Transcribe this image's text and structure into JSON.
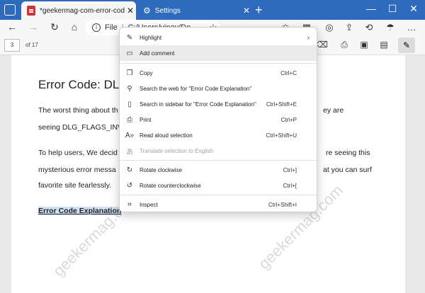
{
  "browser": {
    "tabs": [
      {
        "title": "*geekermag-com-error-code-dlg"
      },
      {
        "title": "Settings"
      }
    ],
    "new_tab": "+",
    "window_controls": [
      "—",
      "☐",
      "✕"
    ],
    "address": {
      "prefix": "File",
      "url": "C:/Users/vinay/De"
    }
  },
  "pdf_toolbar": {
    "page_value": "3",
    "page_total": "of 17"
  },
  "document": {
    "heading": "Error Code: DLG",
    "p1_line1_left": "The worst thing about th",
    "p1_line1_right": "ey are",
    "p1_line2": "seeing DLG_FLAGS_INVA",
    "p2_line1_left": "To help users, We decid",
    "p2_line1_right": "re seeing this",
    "p2_line2_left": "mysterious error messa",
    "p2_line2_right": "at you can surf",
    "p2_line3": "favorite site fearlessly.",
    "bold_heading": "Error Code Explanation"
  },
  "watermark": "geekermag.com",
  "context_menu": {
    "items": [
      {
        "label": "Highlight",
        "shortcut": "",
        "icon": "highlighter-icon",
        "has_submenu": true
      },
      {
        "label": "Add comment",
        "shortcut": "",
        "icon": "comment-icon"
      },
      {
        "label": "Copy",
        "shortcut": "Ctrl+C",
        "icon": "copy-icon"
      },
      {
        "label": "Search the web for \"Error Code Explanation\"",
        "shortcut": "",
        "icon": "search-icon"
      },
      {
        "label": "Search in sidebar for \"Error Code Explanation\"",
        "shortcut": "Ctrl+Shift+E",
        "icon": "sidebar-icon"
      },
      {
        "label": "Print",
        "shortcut": "Ctrl+P",
        "icon": "printer-icon"
      },
      {
        "label": "Read aloud selection",
        "shortcut": "Ctrl+Shift+U",
        "icon": "read-aloud-icon"
      },
      {
        "label": "Translate selection to English",
        "shortcut": "",
        "icon": "translate-icon"
      },
      {
        "label": "Rotate clockwise",
        "shortcut": "Ctrl+]",
        "icon": "rotate-cw-icon"
      },
      {
        "label": "Rotate counterclockwise",
        "shortcut": "Ctrl+[",
        "icon": "rotate-ccw-icon"
      },
      {
        "label": "Inspect",
        "shortcut": "Ctrl+Shift+I",
        "icon": "inspect-icon"
      }
    ]
  },
  "colors": {
    "tabstrip": "#2f6bbd",
    "menu_hover": "#ebebeb",
    "selection": "#cfe0f3"
  }
}
